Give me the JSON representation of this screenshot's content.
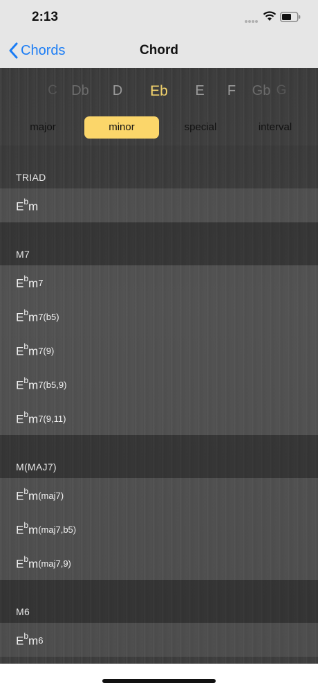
{
  "status": {
    "time": "2:13"
  },
  "nav": {
    "back_label": "Chords",
    "title": "Chord"
  },
  "keys": [
    "C",
    "Db",
    "D",
    "Eb",
    "E",
    "F",
    "Gb",
    "G"
  ],
  "selected_key": "Eb",
  "segments": [
    "major",
    "minor",
    "special",
    "interval"
  ],
  "selected_segment": "minor",
  "sections": {
    "triad": {
      "title": "TRIAD",
      "chords": [
        {
          "root": "E",
          "acc": "b",
          "quality": "m",
          "ext": ""
        }
      ]
    },
    "m7": {
      "title": "M7",
      "chords": [
        {
          "root": "E",
          "acc": "b",
          "quality": "m",
          "ext": "7"
        },
        {
          "root": "E",
          "acc": "b",
          "quality": "m",
          "ext": "7(b5)"
        },
        {
          "root": "E",
          "acc": "b",
          "quality": "m",
          "ext": "7(9)"
        },
        {
          "root": "E",
          "acc": "b",
          "quality": "m",
          "ext": "7(b5,9)"
        },
        {
          "root": "E",
          "acc": "b",
          "quality": "m",
          "ext": "7(9,11)"
        }
      ]
    },
    "mmaj7": {
      "title": "M(MAJ7)",
      "chords": [
        {
          "root": "E",
          "acc": "b",
          "quality": "m",
          "ext": "(maj7)"
        },
        {
          "root": "E",
          "acc": "b",
          "quality": "m",
          "ext": "(maj7,b5)"
        },
        {
          "root": "E",
          "acc": "b",
          "quality": "m",
          "ext": "(maj7,9)"
        }
      ]
    },
    "m6": {
      "title": "M6",
      "chords": [
        {
          "root": "E",
          "acc": "b",
          "quality": "m",
          "ext": "6"
        }
      ]
    }
  },
  "colors": {
    "accent": "#fbd66a",
    "selected_key": "#f3d36c",
    "link": "#1a7cf5"
  }
}
